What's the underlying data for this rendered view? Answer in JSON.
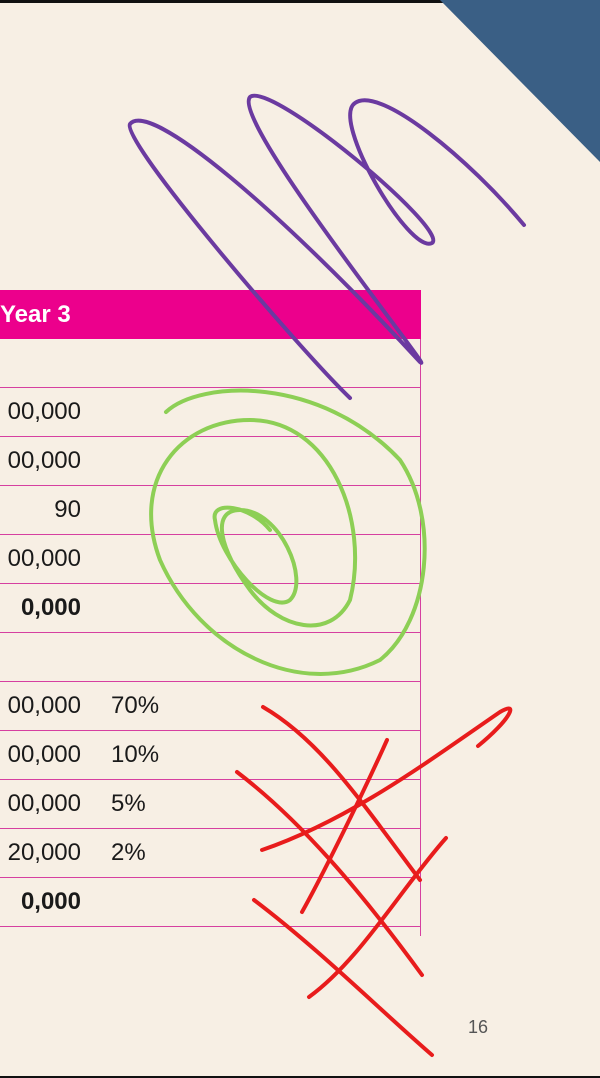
{
  "colors": {
    "background": "#f7efe4",
    "header_fill": "#ec008c",
    "rule_line": "#d63fa0",
    "corner_triangle": "#3a5f85",
    "scribble_purple": "#6b3aa0",
    "scribble_green": "#8dcf55",
    "scribble_red": "#e81c1c"
  },
  "table": {
    "header": {
      "label": "Year 3"
    },
    "rows": [
      {
        "value": "",
        "pct": "",
        "bold": false
      },
      {
        "value": "00,000",
        "pct": "",
        "bold": false
      },
      {
        "value": "00,000",
        "pct": "",
        "bold": false
      },
      {
        "value": "90",
        "pct": "",
        "bold": false
      },
      {
        "value": "00,000",
        "pct": "",
        "bold": false
      },
      {
        "value": "0,000",
        "pct": "",
        "bold": true
      },
      {
        "value": "",
        "pct": "",
        "bold": false
      },
      {
        "value": "00,000",
        "pct": "70%",
        "bold": false
      },
      {
        "value": "00,000",
        "pct": "10%",
        "bold": false
      },
      {
        "value": "00,000",
        "pct": "5%",
        "bold": false
      },
      {
        "value": "20,000",
        "pct": "2%",
        "bold": false
      },
      {
        "value": "0,000",
        "pct": "",
        "bold": true
      }
    ]
  },
  "page_number": "16"
}
